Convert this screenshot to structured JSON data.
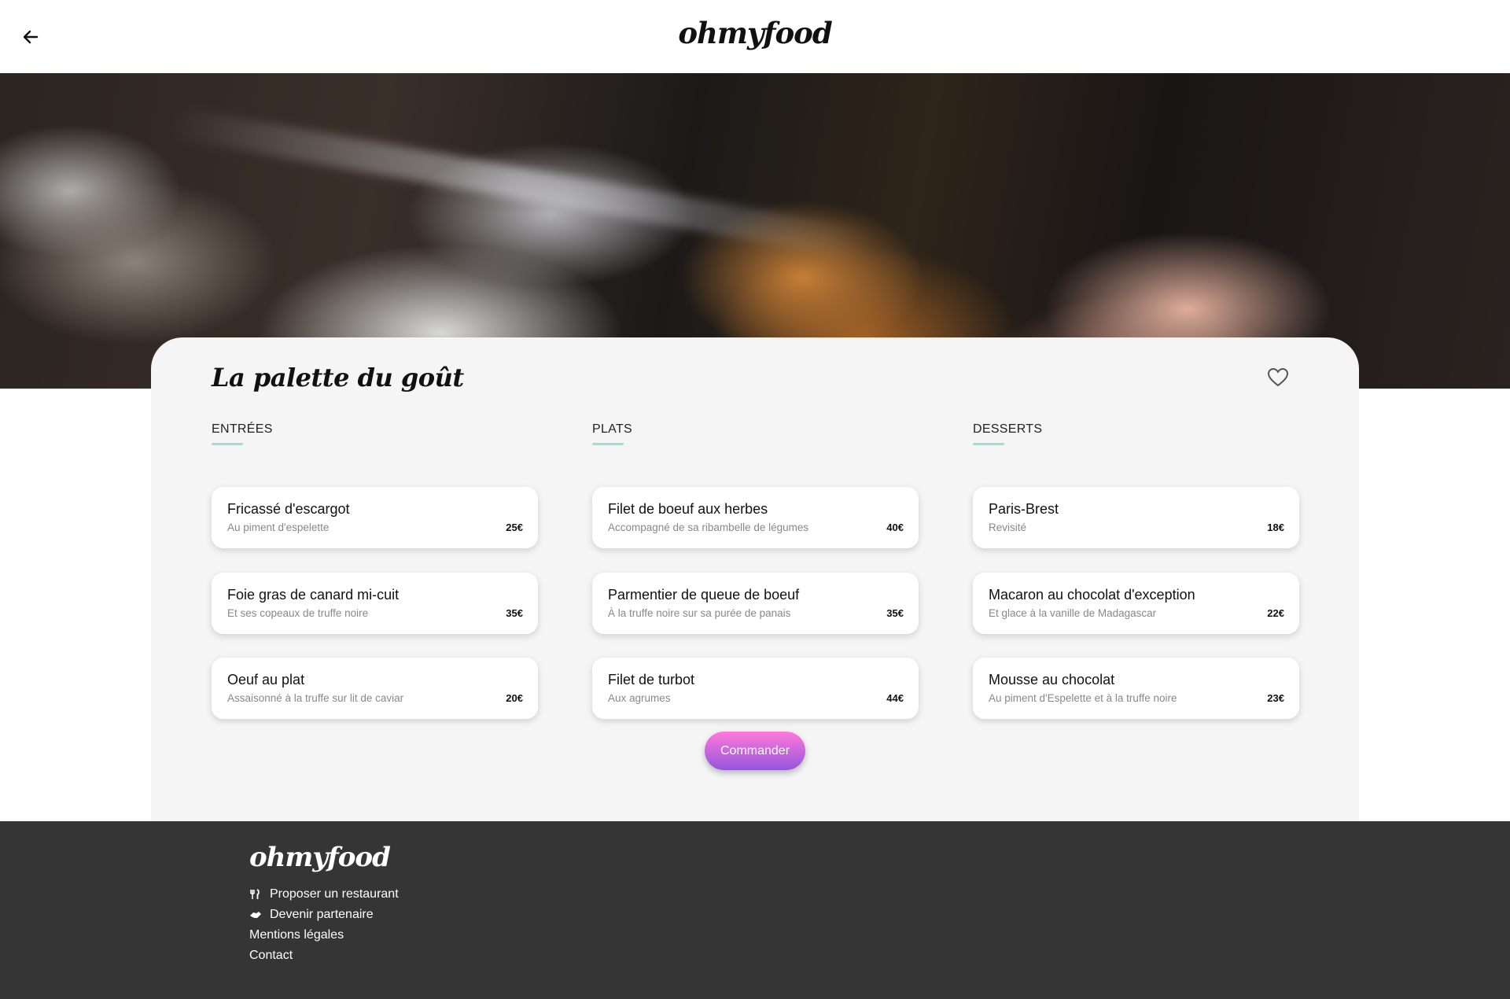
{
  "header": {
    "logo": "ohmyfood",
    "back_icon": "arrow-left-icon"
  },
  "restaurant": {
    "name": "La palette du goût",
    "favorite_icon": "heart-outline-icon"
  },
  "menu": {
    "columns": [
      {
        "heading": "ENTRÉES",
        "dishes": [
          {
            "name": "Fricassé d'escargot",
            "desc": "Au piment d'espelette",
            "price": "25€"
          },
          {
            "name": "Foie gras de canard mi-cuit",
            "desc": "Et ses copeaux de truffe noire",
            "price": "35€"
          },
          {
            "name": "Oeuf au plat",
            "desc": "Assaisonné à la truffe sur lit de caviar",
            "price": "20€"
          }
        ]
      },
      {
        "heading": "PLATS",
        "dishes": [
          {
            "name": "Filet de boeuf aux herbes",
            "desc": "Accompagné de sa ribambelle de légumes",
            "price": "40€"
          },
          {
            "name": "Parmentier de queue de boeuf",
            "desc": "À la truffe noire sur sa purée de panais",
            "price": "35€"
          },
          {
            "name": "Filet de turbot",
            "desc": "Aux agrumes",
            "price": "44€"
          }
        ]
      },
      {
        "heading": "DESSERTS",
        "dishes": [
          {
            "name": "Paris-Brest",
            "desc": "Revisité",
            "price": "18€"
          },
          {
            "name": "Macaron au chocolat d'exception",
            "desc": "Et glace à la vanille de Madagascar",
            "price": "22€"
          },
          {
            "name": "Mousse au chocolat",
            "desc": "Au piment d'Espelette et à la truffe noire",
            "price": "23€"
          }
        ]
      }
    ],
    "order_label": "Commander"
  },
  "footer": {
    "logo": "ohmyfood",
    "links": [
      {
        "label": "Proposer un restaurant",
        "icon": "utensils-icon"
      },
      {
        "label": "Devenir partenaire",
        "icon": "handshake-icon"
      },
      {
        "label": "Mentions légales"
      },
      {
        "label": "Contact"
      }
    ]
  },
  "colors": {
    "accent_underline": "#99e2d0",
    "button_start": "#ff79da",
    "button_end": "#9356dc",
    "footer_bg": "#353535",
    "card_bg": "#f5f5f5"
  }
}
